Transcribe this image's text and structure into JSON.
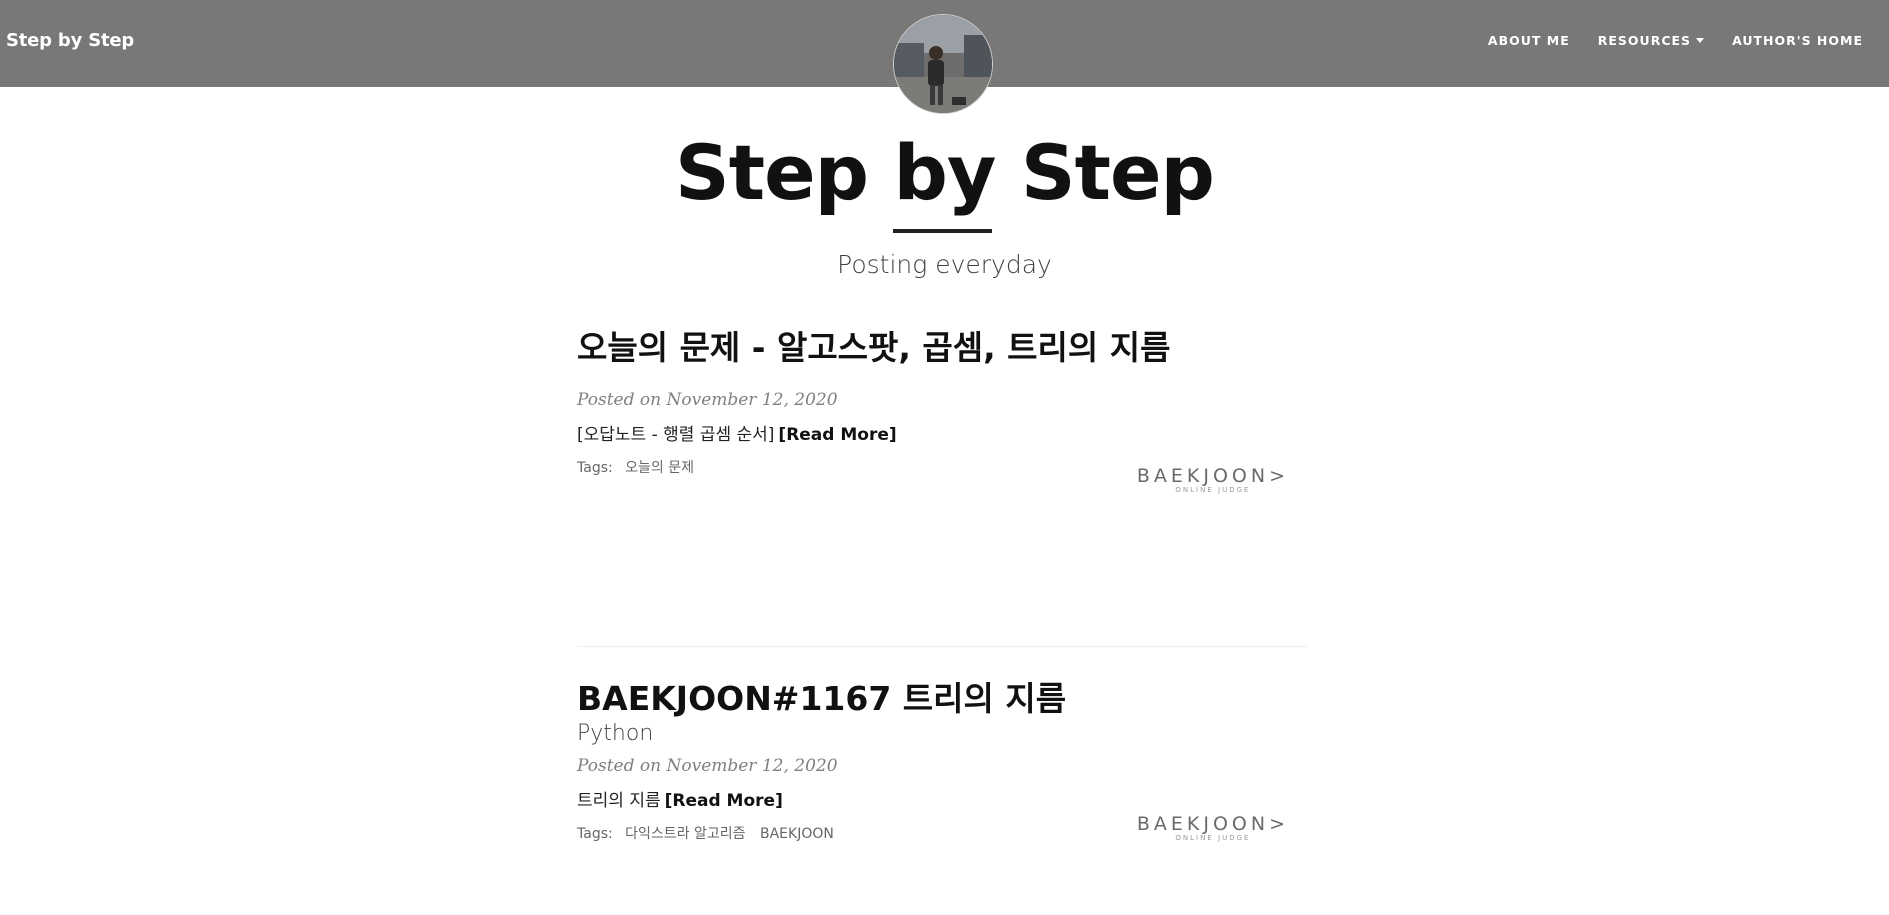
{
  "navbar": {
    "brand": "Step by Step",
    "links": [
      {
        "label": "ABOUT ME"
      },
      {
        "label": "RESOURCES",
        "has_dropdown": true
      },
      {
        "label": "AUTHOR'S HOME"
      }
    ]
  },
  "header": {
    "title": "Step by Step",
    "subtitle": "Posting everyday"
  },
  "posts": [
    {
      "title": "오늘의 문제 - 알고스팟, 곱셈, 트리의 지름",
      "subtitle": "",
      "meta": "Posted on November 12, 2020",
      "excerpt": "[오답노트 - 행렬 곱셈 순서]",
      "read_more": "[Read More]",
      "tags_label": "Tags:",
      "tags": [
        "오늘의 문제"
      ],
      "logo_main": "BAEKJOON>",
      "logo_sub": "ONLINE JUDGE"
    },
    {
      "title": "BAEKJOON#1167 트리의 지름",
      "subtitle": "Python",
      "meta": "Posted on November 12, 2020",
      "excerpt": "트리의 지름",
      "read_more": "[Read More]",
      "tags_label": "Tags:",
      "tags": [
        "다익스트라 알고리즘",
        "BAEKJOON"
      ],
      "logo_main": "BAEKJOON>",
      "logo_sub": "ONLINE JUDGE"
    }
  ],
  "colors": {
    "navbar_bg": "#7a7777",
    "title_text": "#111111",
    "meta_text": "#808080"
  }
}
